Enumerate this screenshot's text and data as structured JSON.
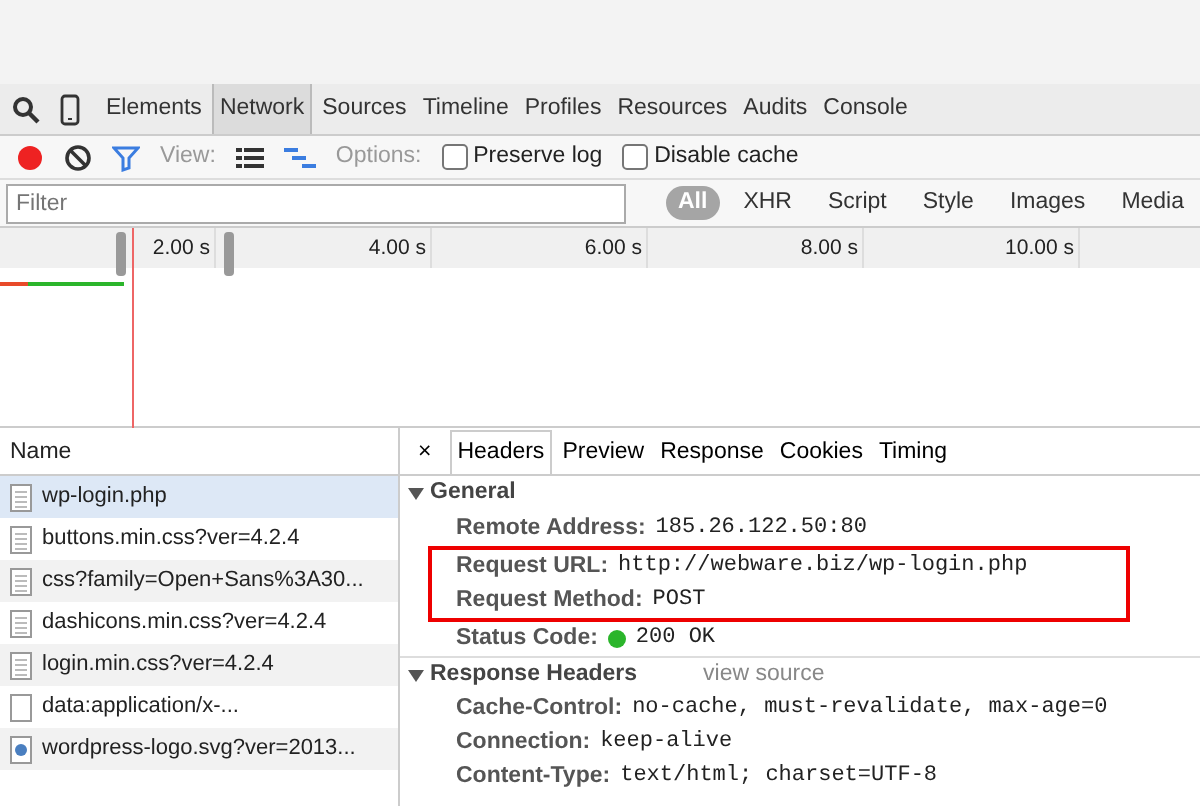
{
  "panel_tabs": [
    {
      "label": "Elements",
      "selected": false
    },
    {
      "label": "Network",
      "selected": true
    },
    {
      "label": "Sources",
      "selected": false
    },
    {
      "label": "Timeline",
      "selected": false
    },
    {
      "label": "Profiles",
      "selected": false
    },
    {
      "label": "Resources",
      "selected": false
    },
    {
      "label": "Audits",
      "selected": false
    },
    {
      "label": "Console",
      "selected": false
    }
  ],
  "toolbar": {
    "recording": true,
    "view_label": "View:",
    "options_label": "Options:",
    "options": [
      {
        "label": "Preserve log",
        "checked": false
      },
      {
        "label": "Disable cache",
        "checked": false
      }
    ]
  },
  "filter": {
    "placeholder": "Filter",
    "types": [
      {
        "label": "All",
        "selected": true
      },
      {
        "label": "XHR",
        "selected": false
      },
      {
        "label": "Script",
        "selected": false
      },
      {
        "label": "Style",
        "selected": false
      },
      {
        "label": "Images",
        "selected": false
      },
      {
        "label": "Media",
        "selected": false
      }
    ]
  },
  "timeline": {
    "ticks": [
      "2.00 s",
      "4.00 s",
      "6.00 s",
      "8.00 s",
      "10.00 s"
    ]
  },
  "requests": {
    "header": "Name",
    "rows": [
      {
        "name": "wp-login.php",
        "kind": "document",
        "selected": true
      },
      {
        "name": "buttons.min.css?ver=4.2.4",
        "kind": "document",
        "selected": false
      },
      {
        "name": "css?family=Open+Sans%3A30...",
        "kind": "document",
        "selected": false
      },
      {
        "name": "dashicons.min.css?ver=4.2.4",
        "kind": "document",
        "selected": false
      },
      {
        "name": "login.min.css?ver=4.2.4",
        "kind": "document",
        "selected": false
      },
      {
        "name": "data:application/x-...",
        "kind": "blank",
        "selected": false
      },
      {
        "name": "wordpress-logo.svg?ver=2013...",
        "kind": "image",
        "selected": false
      }
    ]
  },
  "details": {
    "close": "×",
    "tabs": [
      {
        "label": "Headers",
        "selected": true
      },
      {
        "label": "Preview",
        "selected": false
      },
      {
        "label": "Response",
        "selected": false
      },
      {
        "label": "Cookies",
        "selected": false
      },
      {
        "label": "Timing",
        "selected": false
      }
    ],
    "sections": [
      {
        "title": "General",
        "expanded": true,
        "rows": [
          {
            "key": "Remote Address:",
            "value": "185.26.122.50:80",
            "highlighted": false
          },
          {
            "key": "Request URL:",
            "value": "http://webware.biz/wp-login.php",
            "highlighted": true
          },
          {
            "key": "Request Method:",
            "value": "POST",
            "highlighted": true
          },
          {
            "key": "Status Code:",
            "value": "200 OK",
            "highlighted": false,
            "color": "#2bb52b"
          }
        ]
      },
      {
        "title": "Response Headers",
        "link": "view source",
        "expanded": true,
        "rows": [
          {
            "key": "Cache-Control:",
            "value": "no-cache, must-revalidate, max-age=0",
            "highlighted": false
          },
          {
            "key": "Connection:",
            "value": "keep-alive",
            "highlighted": false
          },
          {
            "key": "Content-Type:",
            "value": "text/html; charset=UTF-8",
            "highlighted": false
          }
        ]
      }
    ]
  }
}
